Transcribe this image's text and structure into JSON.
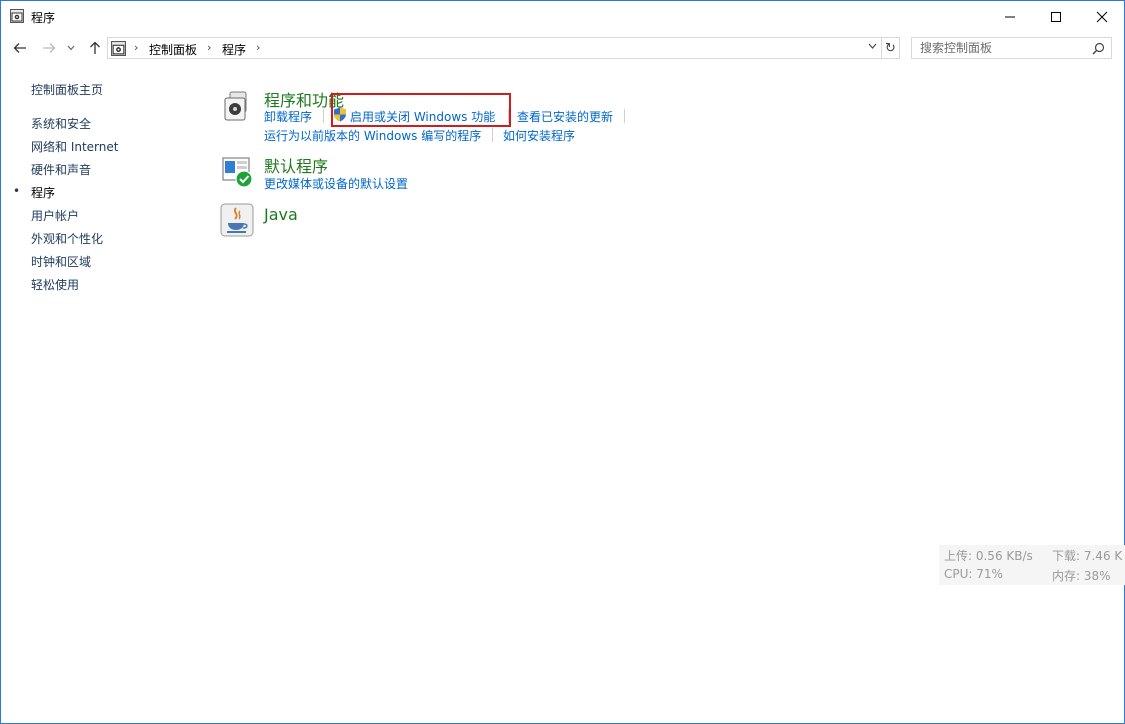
{
  "window": {
    "title": "程序",
    "accent": "#2b7bd4"
  },
  "titlebar": {
    "minimize_icon": "minimize-icon",
    "maximize_icon": "maximize-icon",
    "close_icon": "close-icon"
  },
  "nav": {
    "breadcrumb": [
      "控制面板",
      "程序"
    ],
    "search_placeholder": "搜索控制面板"
  },
  "sidebar": {
    "home": "控制面板主页",
    "items": [
      {
        "label": "系统和安全"
      },
      {
        "label": "网络和 Internet"
      },
      {
        "label": "硬件和声音"
      },
      {
        "label": "程序",
        "current": true
      },
      {
        "label": "用户帐户"
      },
      {
        "label": "外观和个性化"
      },
      {
        "label": "时钟和区域"
      },
      {
        "label": "轻松使用"
      }
    ]
  },
  "categories": {
    "programs": {
      "title": "程序和功能",
      "links": {
        "uninstall": "卸载程序",
        "windows_features": "启用或关闭 Windows 功能",
        "installed_updates": "查看已安装的更新",
        "compat": "运行为以前版本的 Windows 编写的程序",
        "how_install": "如何安装程序"
      }
    },
    "defaults": {
      "title": "默认程序",
      "links": {
        "media_defaults": "更改媒体或设备的默认设置"
      }
    },
    "java": {
      "title": "Java"
    }
  },
  "netmon": {
    "upload": "上传: 0.56 KB/s",
    "download": "下载: 7.46 K",
    "cpu": "CPU: 71%",
    "memory": "内存: 38%"
  },
  "colors": {
    "category_title": "#1e7a1e",
    "link": "#0066cc",
    "highlight": "#d01c1c"
  }
}
